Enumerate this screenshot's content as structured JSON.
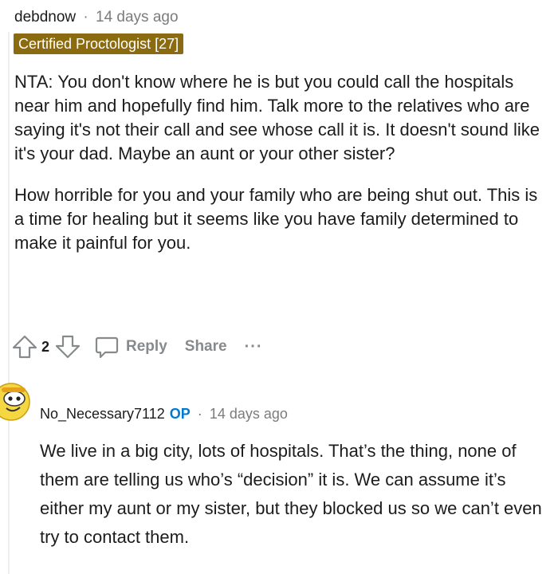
{
  "comment": {
    "author": "debdnow",
    "separator": "·",
    "time": "14 days ago",
    "flair": "Certified Proctologist [27]",
    "paragraphs": [
      "NTA: You don't know where he is but you could call the hospitals near him and hopefully find him. Talk more to the relatives who are saying it's not their call and see whose call it is. It doesn't sound like it's your dad. Maybe an aunt or your other sister?",
      "How horrible for you and your family who are being shut out. This is a time for healing but it seems like you have family determined to make it painful for you."
    ],
    "votes": "2",
    "reply_label": "Reply",
    "share_label": "Share",
    "more_label": "···"
  },
  "reply": {
    "author": "No_Necessary7112",
    "op_badge": "OP",
    "separator": "·",
    "time": "14 days ago",
    "text": "We live in a big city, lots of hospitals. That’s the thing, none of them are telling us who’s “decision” it is. We can assume it’s either my aunt or my sister, but they blocked us so we can’t even try to contact them."
  },
  "icons": {
    "upvote": "upvote-arrow-icon",
    "downvote": "downvote-arrow-icon",
    "reply": "speech-bubble-icon",
    "avatar": "snoo-avatar-icon"
  },
  "colors": {
    "flair_bg": "#8b6b10",
    "op_blue": "#0079d3",
    "meta_gray": "#7c7c7c",
    "action_gray": "#878a8c"
  }
}
